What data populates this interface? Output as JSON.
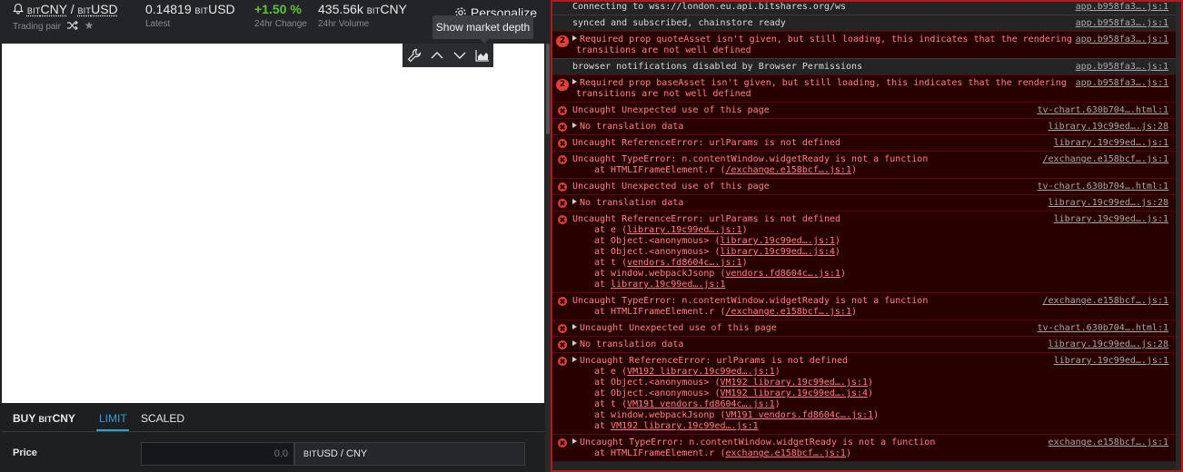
{
  "market": {
    "pair_base": "CNY",
    "pair_quote": "USD",
    "bit_prefix": "BIT",
    "separator": "/",
    "trading_pair_label": "Trading pair",
    "latest_value": "0.14819",
    "latest_label": "Latest",
    "change_value": "+1.50 %",
    "change_label": "24hr Change",
    "volume_value": "435.56k",
    "volume_label": "24hr Volume",
    "personalize_label": "Personalize"
  },
  "chart": {
    "tooltip": "Show market depth"
  },
  "order": {
    "buy_label": "BUY",
    "tab_limit": "LIMIT",
    "tab_scaled": "SCALED",
    "price_label": "Price",
    "price_value": "0.0",
    "price_unit": "USD / CNY"
  },
  "colors": {
    "accent": "#2f9fdc",
    "positive": "#5fc33a",
    "error_text": "#ff8080",
    "error_bg": "#290000"
  },
  "console": {
    "messages": [
      {
        "type": "info",
        "text": "Connecting to wss://london.eu.api.bitshares.org/ws",
        "source": "app.b958fa3….js:1"
      },
      {
        "type": "info",
        "text": "synced and subscribed, chainstore ready",
        "source": "app.b958fa3….js:1"
      },
      {
        "type": "error",
        "count": "2",
        "expandable": true,
        "text": "Required prop quoteAsset isn't given, but still loading, this indicates that the rendering",
        "text2": "transitions are not well defined",
        "source": "app.b958fa3….js:1"
      },
      {
        "type": "info",
        "text": "browser notifications disabled by Browser Permissions",
        "source": "app.b958fa3….js:1"
      },
      {
        "type": "error",
        "count": "2",
        "expandable": true,
        "text": "Required prop baseAsset isn't given, but still loading, this indicates that the rendering",
        "text2": "transitions are not well defined",
        "source": "app.b958fa3….js:1"
      },
      {
        "type": "error",
        "text": "Uncaught Unexpected use of this page",
        "source": "tv-chart.630b704….html:1"
      },
      {
        "type": "error",
        "expandable": true,
        "text": "No translation data",
        "source": "library.19c99ed….js:28"
      },
      {
        "type": "error",
        "text": "Uncaught ReferenceError: urlParams is not defined",
        "source": "library.19c99ed….js:1"
      },
      {
        "type": "error",
        "text": "Uncaught TypeError: n.contentWindow.widgetReady is not a function",
        "source": "/exchange.e158bcf….js:1",
        "stack": [
          {
            "pre": "at HTMLIFrameElement.r (",
            "link": "/exchange.e158bcf….js:1",
            "post": ")"
          }
        ]
      },
      {
        "type": "error",
        "text": "Uncaught Unexpected use of this page",
        "source": "tv-chart.630b704….html:1"
      },
      {
        "type": "error",
        "expandable": true,
        "text": "No translation data",
        "source": "library.19c99ed….js:28"
      },
      {
        "type": "error",
        "text": "Uncaught ReferenceError: urlParams is not defined",
        "source": "library.19c99ed….js:1",
        "stack": [
          {
            "pre": "at e (",
            "link": "library.19c99ed….js:1",
            "post": ")"
          },
          {
            "pre": "at Object.<anonymous> (",
            "link": "library.19c99ed….js:1",
            "post": ")"
          },
          {
            "pre": "at Object.<anonymous> (",
            "link": "library.19c99ed….js:4",
            "post": ")"
          },
          {
            "pre": "at t (",
            "link": "vendors.fd8604c….js:1",
            "post": ")"
          },
          {
            "pre": "at window.webpackJsonp (",
            "link": "vendors.fd8604c….js:1",
            "post": ")"
          },
          {
            "pre": "at ",
            "link": "library.19c99ed….js:1",
            "post": ""
          }
        ]
      },
      {
        "type": "error",
        "text": "Uncaught TypeError: n.contentWindow.widgetReady is not a function",
        "source": "/exchange.e158bcf….js:1",
        "stack": [
          {
            "pre": "at HTMLIFrameElement.r (",
            "link": "/exchange.e158bcf….js:1",
            "post": ")"
          }
        ]
      },
      {
        "type": "error",
        "expandable": true,
        "text": "Uncaught Unexpected use of this page",
        "source": "tv-chart.630b704….html:1"
      },
      {
        "type": "error",
        "expandable": true,
        "text": "No translation data",
        "source": "library.19c99ed….js:28"
      },
      {
        "type": "error",
        "expandable": true,
        "text": "Uncaught ReferenceError: urlParams is not defined",
        "source": "library.19c99ed….js:1",
        "stack": [
          {
            "pre": "at e (",
            "link": "VM192 library.19c99ed….js:1",
            "post": ")"
          },
          {
            "pre": "at Object.<anonymous> (",
            "link": "VM192 library.19c99ed….js:1",
            "post": ")"
          },
          {
            "pre": "at Object.<anonymous> (",
            "link": "VM192 library.19c99ed….js:4",
            "post": ")"
          },
          {
            "pre": "at t (",
            "link": "VM191 vendors.fd8604c….js:1",
            "post": ")"
          },
          {
            "pre": "at window.webpackJsonp (",
            "link": "VM191 vendors.fd8604c….js:1",
            "post": ")"
          },
          {
            "pre": "at ",
            "link": "VM192 library.19c99ed….js:1",
            "post": ""
          }
        ]
      },
      {
        "type": "error",
        "expandable": true,
        "text": "Uncaught TypeError: n.contentWindow.widgetReady is not a function",
        "source": "exchange.e158bcf….js:1",
        "stack": [
          {
            "pre": "at HTMLIFrameElement.r (",
            "link": "exchange.e158bcf….js:1",
            "post": ")"
          }
        ]
      }
    ]
  }
}
